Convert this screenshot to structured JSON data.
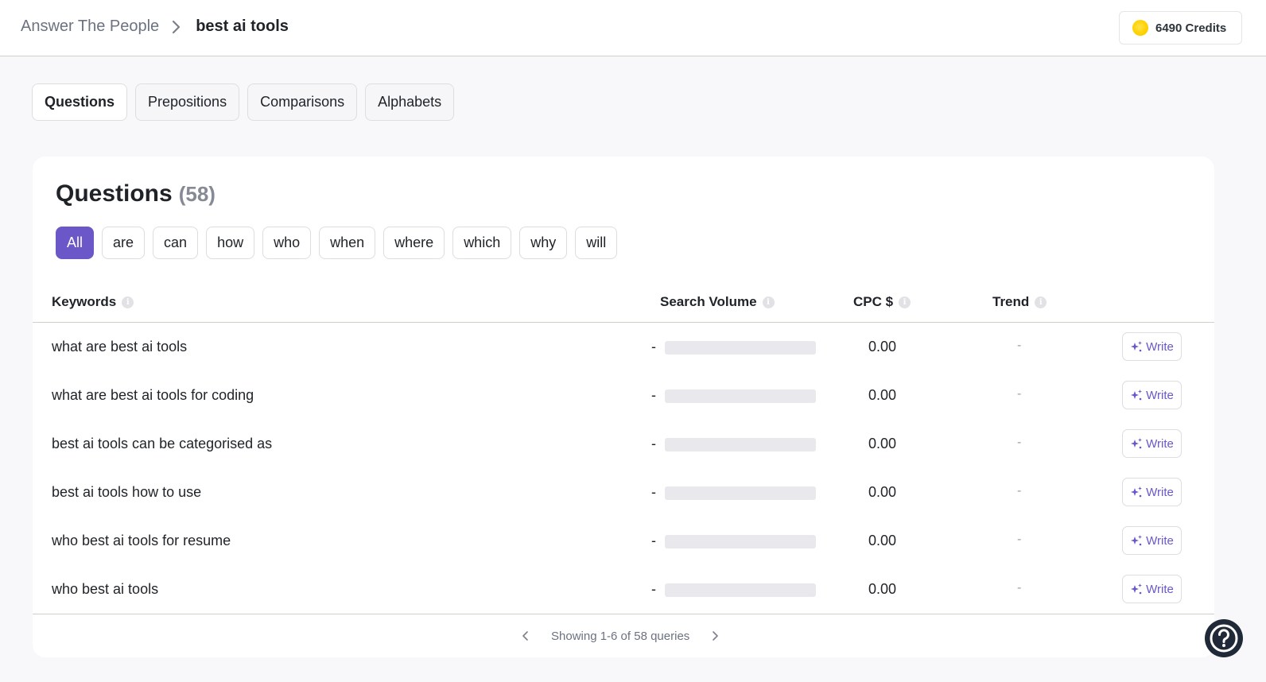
{
  "header": {
    "breadcrumb_root": "Answer The People",
    "breadcrumb_current": "best ai tools",
    "credits_label": "6490 Credits"
  },
  "tabs": [
    {
      "label": "Questions",
      "active": true
    },
    {
      "label": "Prepositions",
      "active": false
    },
    {
      "label": "Comparisons",
      "active": false
    },
    {
      "label": "Alphabets",
      "active": false
    }
  ],
  "section": {
    "title": "Questions",
    "count": "(58)"
  },
  "filters": [
    {
      "label": "All",
      "active": true
    },
    {
      "label": "are",
      "active": false
    },
    {
      "label": "can",
      "active": false
    },
    {
      "label": "how",
      "active": false
    },
    {
      "label": "who",
      "active": false
    },
    {
      "label": "when",
      "active": false
    },
    {
      "label": "where",
      "active": false
    },
    {
      "label": "which",
      "active": false
    },
    {
      "label": "why",
      "active": false
    },
    {
      "label": "will",
      "active": false
    }
  ],
  "table": {
    "columns": {
      "keywords": "Keywords",
      "search_volume": "Search Volume",
      "cpc": "CPC $",
      "trend": "Trend"
    },
    "info_icon": "i",
    "rows": [
      {
        "keyword": "what are best ai tools",
        "search_volume": "-",
        "cpc": "0.00",
        "trend": "-",
        "action": "Write"
      },
      {
        "keyword": "what are best ai tools for coding",
        "search_volume": "-",
        "cpc": "0.00",
        "trend": "-",
        "action": "Write"
      },
      {
        "keyword": "best ai tools can be categorised as",
        "search_volume": "-",
        "cpc": "0.00",
        "trend": "-",
        "action": "Write"
      },
      {
        "keyword": "best ai tools how to use",
        "search_volume": "-",
        "cpc": "0.00",
        "trend": "-",
        "action": "Write"
      },
      {
        "keyword": "who best ai tools for resume",
        "search_volume": "-",
        "cpc": "0.00",
        "trend": "-",
        "action": "Write"
      },
      {
        "keyword": "who best ai tools",
        "search_volume": "-",
        "cpc": "0.00",
        "trend": "-",
        "action": "Write"
      }
    ]
  },
  "pagination": {
    "label": "Showing 1-6 of 58 queries"
  },
  "icons": {
    "breadcrumb_separator": "chevron-right-icon",
    "credits": "coin-icon",
    "write": "sparkle-icon",
    "prev": "chevron-left-icon",
    "next": "chevron-right-icon",
    "help": "help-circle-icon"
  },
  "colors": {
    "accent": "#6b57c8",
    "page_bg": "#f8f8fa",
    "card_bg": "#ffffff",
    "bar_placeholder": "#e9e9ed",
    "coin": "#ffd200",
    "help_bg": "#1f2937"
  }
}
